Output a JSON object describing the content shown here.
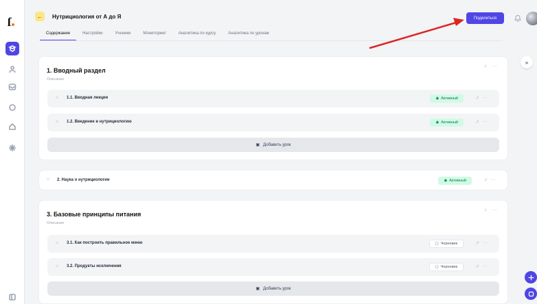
{
  "app": {
    "logo_letter": "ſ"
  },
  "header": {
    "course_title": "Нутрициология от А до Я",
    "share_label": "Поделиться"
  },
  "tabs": [
    {
      "label": "Содержание",
      "active": true
    },
    {
      "label": "Настройки",
      "active": false
    },
    {
      "label": "Ученики",
      "active": false
    },
    {
      "label": "Мониторинг",
      "active": false
    },
    {
      "label": "Аналитика по курсу",
      "active": false
    },
    {
      "label": "Аналитика по урокам",
      "active": false
    }
  ],
  "sections": [
    {
      "title": "1. Вводный раздел",
      "description": "Описание",
      "lessons": [
        {
          "name": "1.1. Вводная лекция",
          "status": "Активный"
        },
        {
          "name": "1.2. Введение в нутрициологию",
          "status": "Активный"
        }
      ],
      "add_label": "Добавить урок"
    },
    {
      "title": "2. Наука о нутрициологии",
      "status": "Активный"
    },
    {
      "title": "3. Базовые принципы питания",
      "description": "Описание",
      "lessons": [
        {
          "name": "3.1. Как построить правильное меню",
          "status": "Черновик"
        },
        {
          "name": "3.2. Продукты исключения",
          "status": "Черновик"
        }
      ],
      "add_label": "Добавить урок"
    }
  ],
  "colors": {
    "accent": "#4f46e5",
    "active_badge": "#d1fae5",
    "arrow": "#dc2626"
  }
}
